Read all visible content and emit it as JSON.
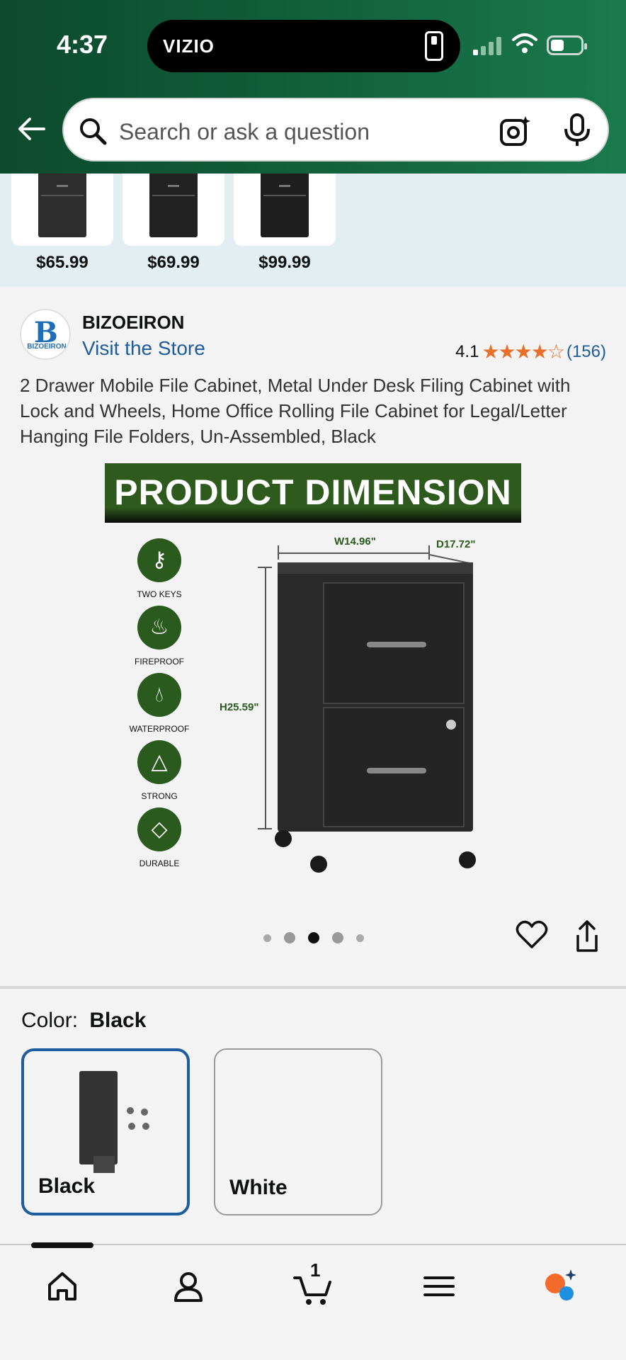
{
  "status_bar": {
    "time": "4:37",
    "island_label": "VIZIO"
  },
  "search": {
    "placeholder": "Search or ask a question"
  },
  "related_products": [
    {
      "price": "$65.99"
    },
    {
      "price": "$69.99"
    },
    {
      "price": "$99.99"
    }
  ],
  "product": {
    "brand_name": "BIZOEIRON",
    "brand_logo_letter": "B",
    "brand_logo_word": "BIZOEIRON",
    "visit_store": "Visit the Store",
    "rating_value": "4.1",
    "rating_stars": 4.1,
    "rating_count": "(156)",
    "title": "2 Drawer Mobile File Cabinet, Metal Under Desk Filing Cabinet with Lock and Wheels, Home Office Rolling File Cabinet for Legal/Letter Hanging File Folders, Un-Assembled, Black"
  },
  "image": {
    "banner": "PRODUCT DIMENSION",
    "features": [
      "TWO KEYS",
      "FIREPROOF",
      "WATERPROOF",
      "STRONG",
      "DURABLE"
    ],
    "width": "W14.96\"",
    "depth": "D17.72\"",
    "height": "H25.59\"",
    "carousel_active_index": 2,
    "carousel_count": 5
  },
  "color": {
    "label": "Color:",
    "selected": "Black",
    "options": [
      "Black",
      "White"
    ]
  },
  "nav": {
    "cart_count": "1"
  },
  "colors": {
    "header_green": "#115d3a",
    "link_blue": "#1f5c9e",
    "star_orange": "#e8702a",
    "banner_green": "#2f5a1d"
  }
}
